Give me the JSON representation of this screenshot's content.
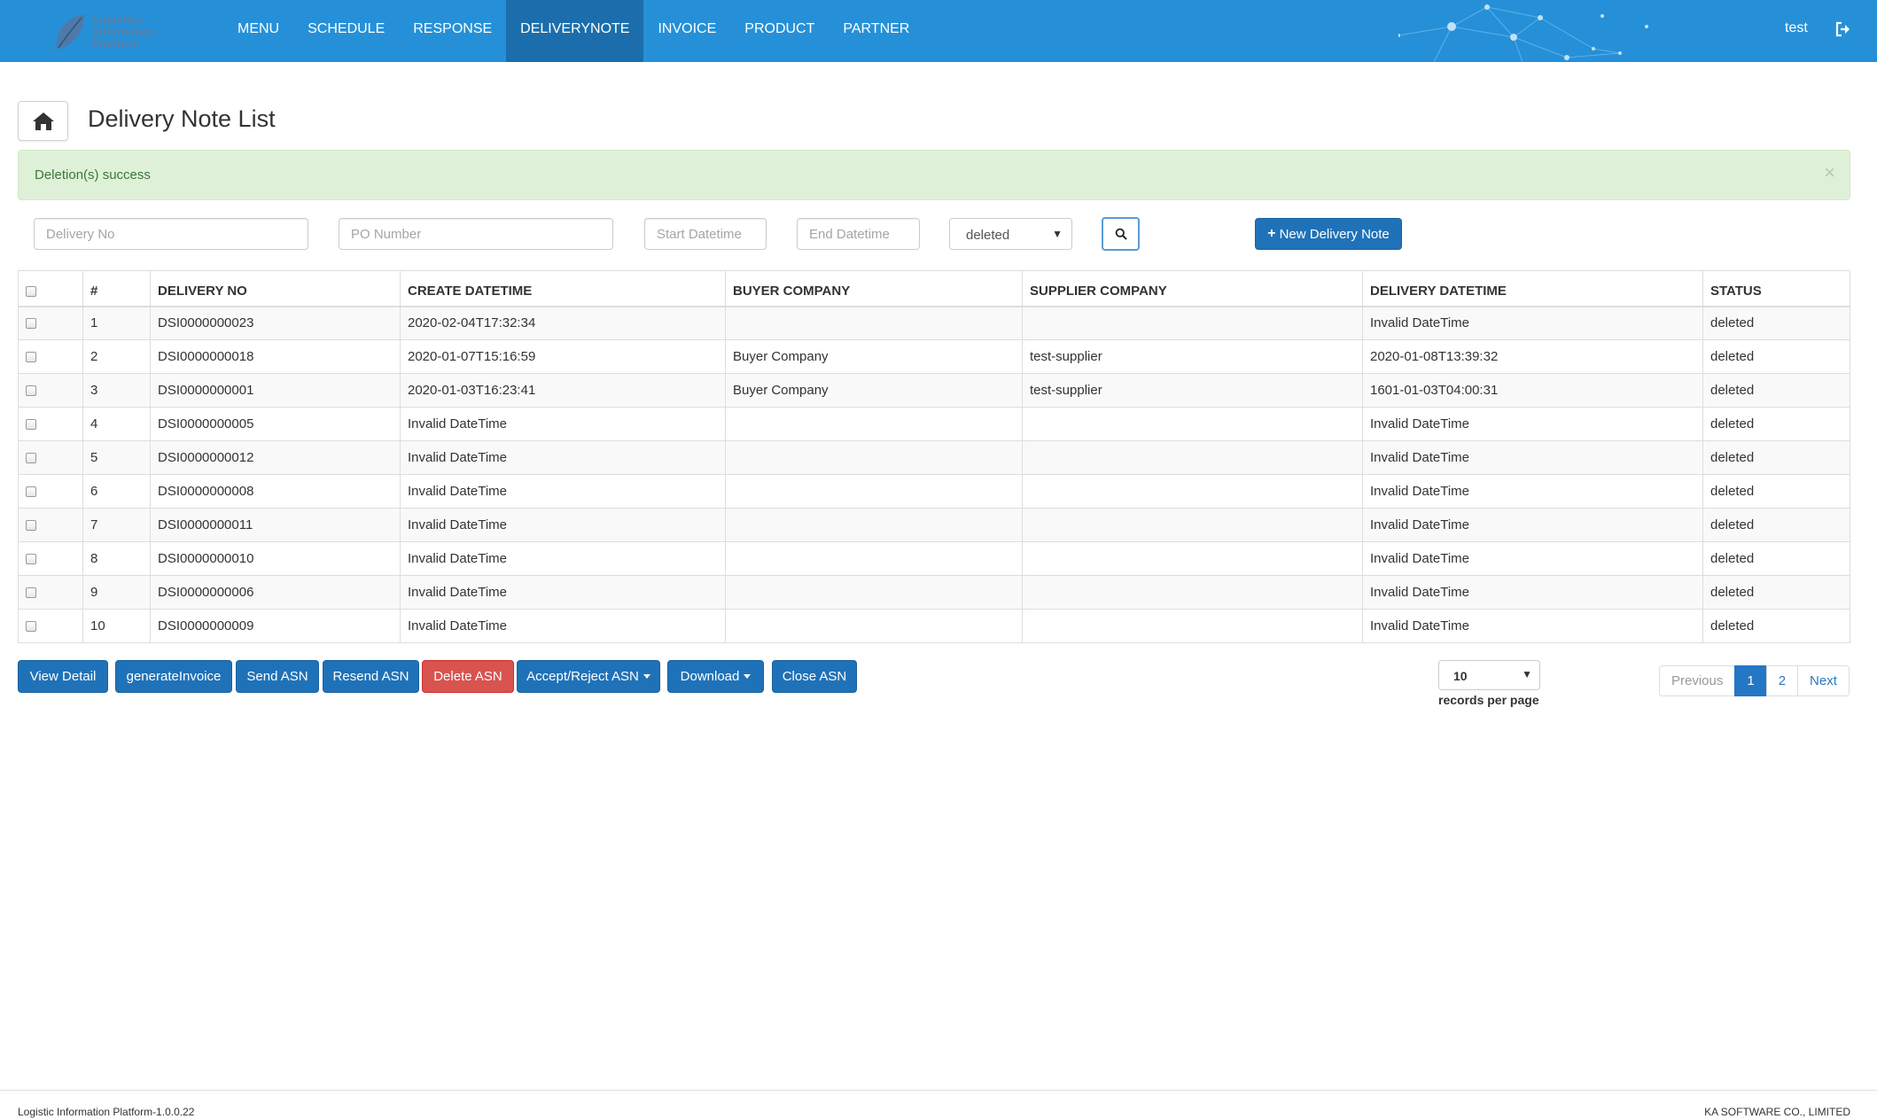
{
  "navbar": {
    "logo_lines": [
      "Logistics",
      "Information",
      "Platform"
    ],
    "items": [
      {
        "label": "MENU",
        "active": false
      },
      {
        "label": "SCHEDULE",
        "active": false
      },
      {
        "label": "RESPONSE",
        "active": false
      },
      {
        "label": "DELIVERYNOTE",
        "active": true
      },
      {
        "label": "INVOICE",
        "active": false
      },
      {
        "label": "PRODUCT",
        "active": false
      },
      {
        "label": "PARTNER",
        "active": false
      }
    ],
    "user": "test",
    "brand_color": "#2590d8",
    "active_color": "#1b6eab"
  },
  "header": {
    "title": "Delivery Note List"
  },
  "alert": {
    "message": "Deletion(s) success",
    "close": "×"
  },
  "filters": {
    "delivery_no_placeholder": "Delivery No",
    "po_number_placeholder": "PO Number",
    "start_datetime_placeholder": "Start Datetime",
    "end_datetime_placeholder": "End Datetime",
    "status_value": "deleted",
    "new_button": "New Delivery Note"
  },
  "table": {
    "columns": [
      "#",
      "DELIVERY NO",
      "CREATE DATETIME",
      "BUYER COMPANY",
      "SUPPLIER COMPANY",
      "DELIVERY DATETIME",
      "STATUS"
    ],
    "rows": [
      [
        "1",
        "DSI0000000023",
        "2020-02-04T17:32:34",
        "",
        "",
        "Invalid DateTime",
        "deleted"
      ],
      [
        "2",
        "DSI0000000018",
        "2020-01-07T15:16:59",
        "Buyer Company",
        "test-supplier",
        "2020-01-08T13:39:32",
        "deleted"
      ],
      [
        "3",
        "DSI0000000001",
        "2020-01-03T16:23:41",
        "Buyer Company",
        "test-supplier",
        "1601-01-03T04:00:31",
        "deleted"
      ],
      [
        "4",
        "DSI0000000005",
        "Invalid DateTime",
        "",
        "",
        "Invalid DateTime",
        "deleted"
      ],
      [
        "5",
        "DSI0000000012",
        "Invalid DateTime",
        "",
        "",
        "Invalid DateTime",
        "deleted"
      ],
      [
        "6",
        "DSI0000000008",
        "Invalid DateTime",
        "",
        "",
        "Invalid DateTime",
        "deleted"
      ],
      [
        "7",
        "DSI0000000011",
        "Invalid DateTime",
        "",
        "",
        "Invalid DateTime",
        "deleted"
      ],
      [
        "8",
        "DSI0000000010",
        "Invalid DateTime",
        "",
        "",
        "Invalid DateTime",
        "deleted"
      ],
      [
        "9",
        "DSI0000000006",
        "Invalid DateTime",
        "",
        "",
        "Invalid DateTime",
        "deleted"
      ],
      [
        "10",
        "DSI0000000009",
        "Invalid DateTime",
        "",
        "",
        "Invalid DateTime",
        "deleted"
      ]
    ]
  },
  "actions": {
    "view_detail": "View Detail",
    "generate_invoice": "generateInvoice",
    "send_asn": "Send ASN",
    "resend_asn": "Resend ASN",
    "delete_asn": "Delete ASN",
    "accept_reject_asn": "Accept/Reject ASN",
    "download": "Download",
    "close_asn": "Close ASN",
    "primary_color": "#1f72b8",
    "danger_color": "#d9534f"
  },
  "paging": {
    "records_per_page_value": "10",
    "records_per_page_label": "records per page",
    "previous": "Previous",
    "pages": [
      "1",
      "2"
    ],
    "current_page": "1",
    "next": "Next"
  },
  "footer": {
    "version": "Logistic Information Platform-1.0.0.22",
    "company": "KA SOFTWARE CO., LIMITED"
  }
}
